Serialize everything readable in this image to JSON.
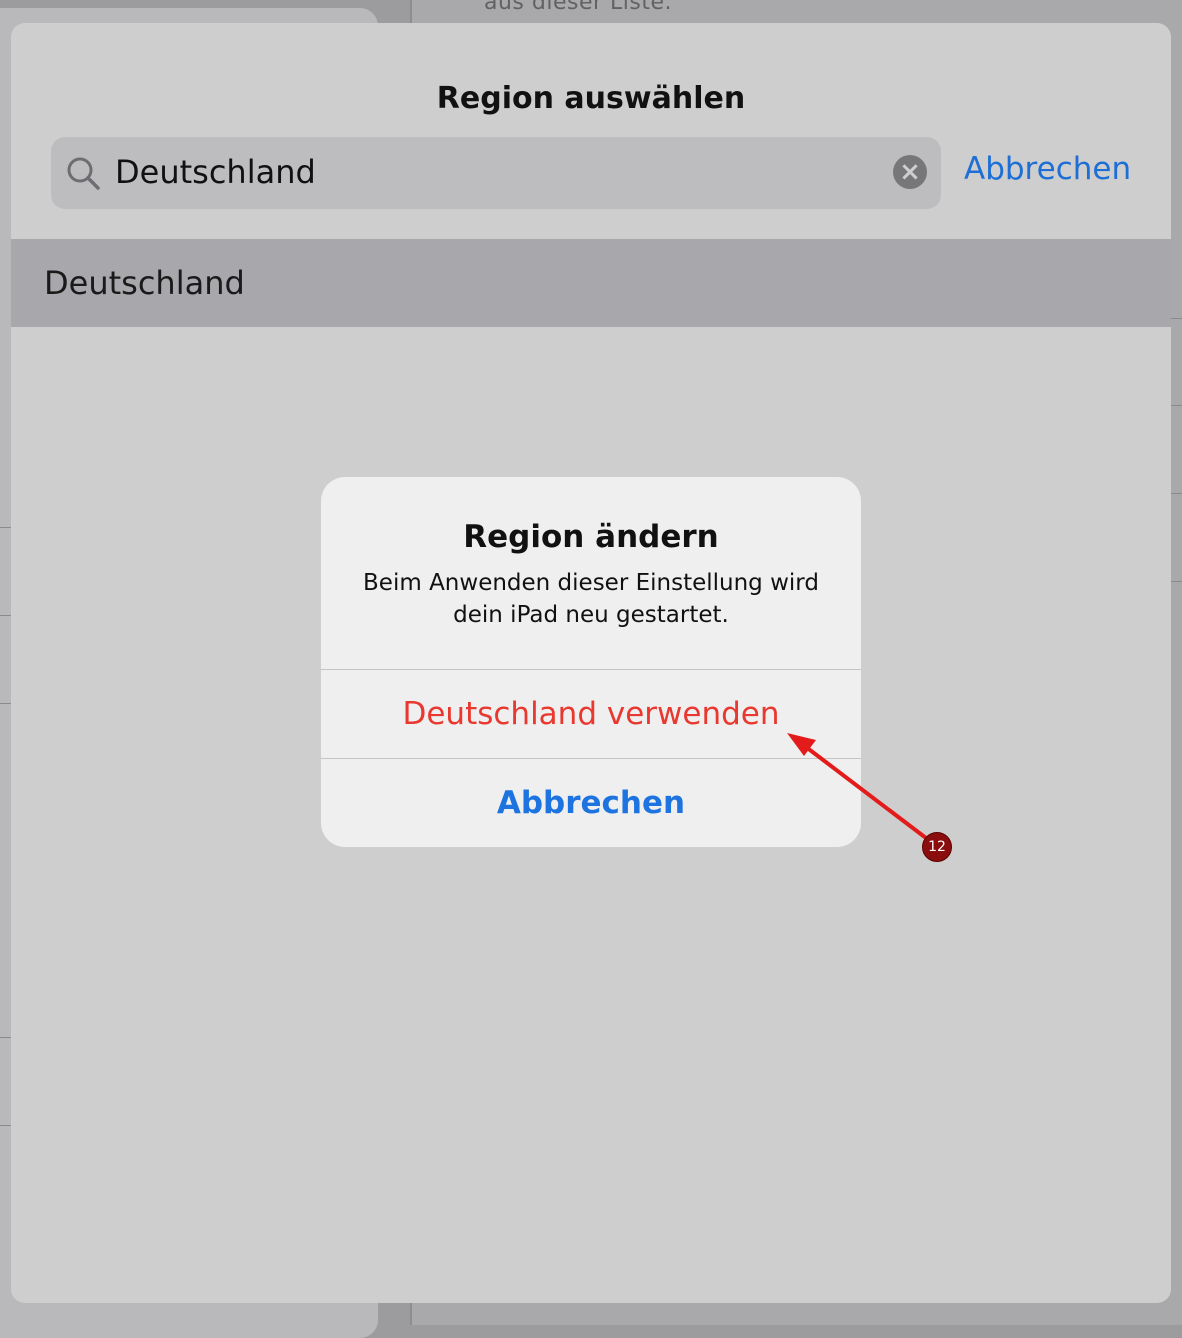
{
  "background": {
    "hint_text": "aus dieser Liste."
  },
  "sheet": {
    "title": "Region auswählen",
    "search": {
      "value": "Deutschland",
      "icon": "search-icon",
      "clear_icon": "clear-icon"
    },
    "cancel_label": "Abbrechen",
    "results": [
      {
        "label": "Deutschland"
      }
    ]
  },
  "alert": {
    "title": "Region ändern",
    "message": "Beim Anwenden dieser Einstellung wird dein iPad neu gestartet.",
    "confirm_label": "Deutschland verwenden",
    "cancel_label": "Abbrechen"
  },
  "annotation": {
    "step_number": "12",
    "arrow_color": "#e31b1b",
    "marker_color": "#8a0e0e"
  },
  "colors": {
    "accent_blue": "#1d74e0",
    "destructive_red": "#e8382f"
  }
}
